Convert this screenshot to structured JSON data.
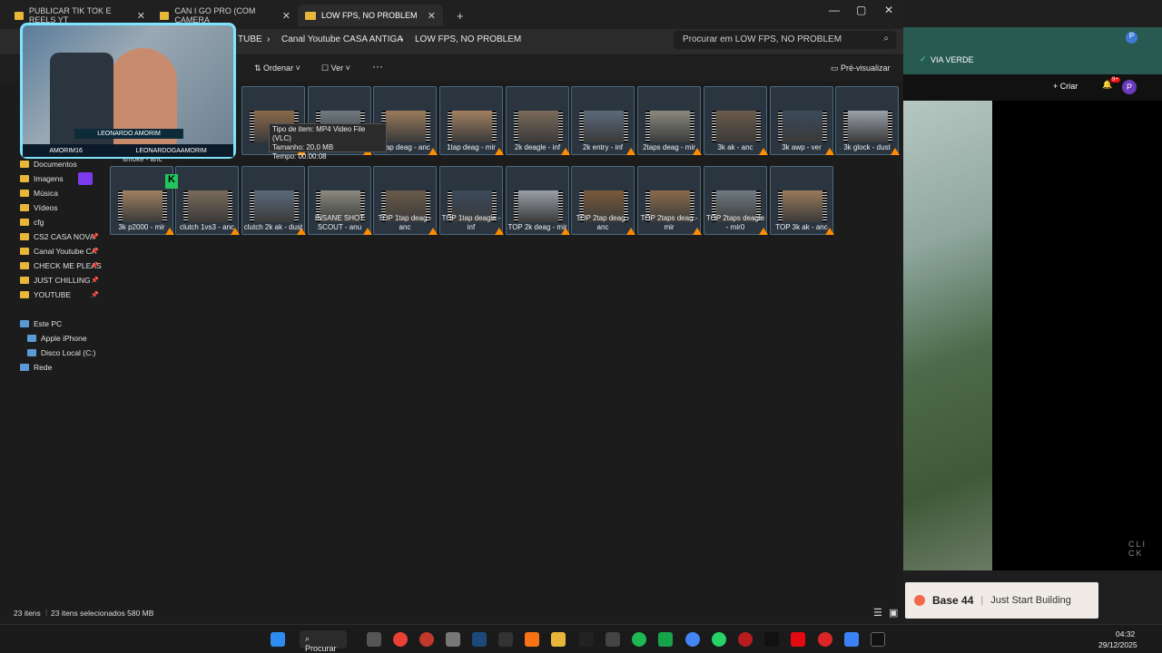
{
  "explorer": {
    "tabs": [
      {
        "label": "PUBLICAR TIK TOK E REELS YT"
      },
      {
        "label": "CAN I GO PRO (COM CAMERA"
      },
      {
        "label": "LOW FPS, NO PROBLEM"
      }
    ],
    "breadcrumb": [
      "TUBE",
      "Canal Youtube CASA ANTIGA",
      "LOW FPS, NO PROBLEM"
    ],
    "search_placeholder": "Procurar em LOW FPS, NO PROBLEM",
    "toolbar": {
      "sort": "Ordenar",
      "view": "Ver",
      "more": "···",
      "preview": "Pré-visualizar"
    },
    "nav": [
      {
        "label": "Documentos",
        "icon": "documents-icon"
      },
      {
        "label": "Imagens",
        "icon": "images-icon"
      },
      {
        "label": "Música",
        "icon": "music-icon"
      },
      {
        "label": "Vídeos",
        "icon": "videos-icon"
      },
      {
        "label": "cfg",
        "icon": "folder-icon"
      },
      {
        "label": "CS2 CASA NOVA",
        "icon": "folder-icon"
      },
      {
        "label": "Canal Youtube CA",
        "icon": "folder-icon"
      },
      {
        "label": "CHECK ME PLEAS",
        "icon": "folder-icon"
      },
      {
        "label": "JUST CHILLING",
        "icon": "folder-icon"
      },
      {
        "label": "YOUTUBE",
        "icon": "folder-icon"
      }
    ],
    "nav_pc": [
      {
        "label": "Este PC",
        "icon": "pc-icon"
      },
      {
        "label": "Apple iPhone",
        "icon": "phone-icon"
      },
      {
        "label": "Disco Local (C:)",
        "icon": "disk-icon"
      },
      {
        "label": "Rede",
        "icon": "network-icon"
      }
    ],
    "files_row1": [
      "1p",
      "",
      "1tap deag - anc",
      "1tap deag - mir",
      "2k deagle - inf",
      "2k entry - inf",
      "2taps deag - mir",
      "3k ak - anc",
      "3k awp - ver",
      "3k glock - dust"
    ],
    "files_row2": [
      "3k p2000 - mir",
      "clutch 1vs3 - anc",
      "clutch 2k ak - dust",
      "INSANE SHOT SCOUT - anu",
      "TOP 1tap deag - anc",
      "TOP 1tap deagle - inf",
      "TOP 2k deag - mir",
      "TOP 2tap deag - anc",
      "TOP 2taps deag - mir",
      "TOP 2taps deagle - mir0",
      "TOP 3k ak - anc"
    ],
    "partial_label": "smoke - anc",
    "tooltip": [
      "Tipo de item: MP4 Video File (VLC)",
      "Tamanho: 20,0 MB",
      "Tempo: 00:00:08"
    ],
    "status": {
      "count": "23 itens",
      "selected": "23 itens selecionados 580 MB"
    }
  },
  "webcam": {
    "name": "LEONARDO AMORIM",
    "handle1": "AMORIM16",
    "handle2": "LEONARDOGAAMORIM"
  },
  "browser": {
    "bookmark": "VIA VERDE",
    "create": "Criar",
    "notif": "9+",
    "avatar": "P",
    "watermark": "CLI\nCK",
    "ad_logo": "Base 44",
    "ad_text": "Just Start Building"
  },
  "taskbar": {
    "search": "Procurar",
    "time": "04:32",
    "date": "29/12/2025"
  },
  "colors": {
    "accent": "#7de3ff",
    "folder": "#e8b73a",
    "selection": "#4a6a80"
  }
}
